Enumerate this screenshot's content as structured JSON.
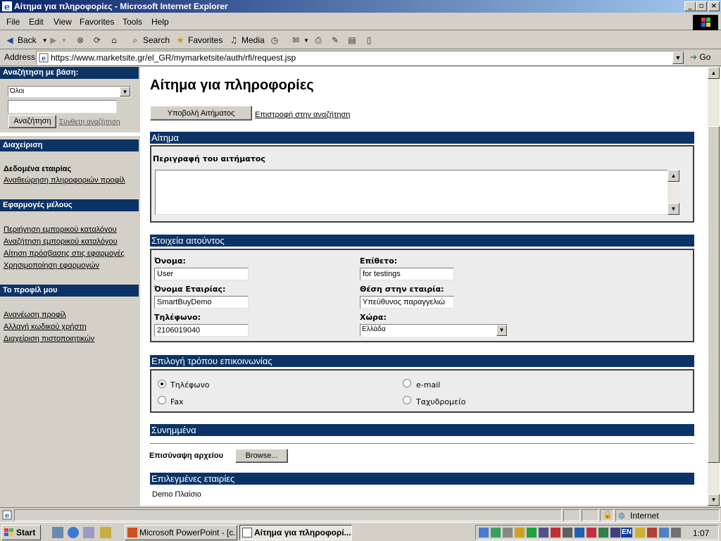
{
  "window": {
    "title": "Αίτημα για πληροφορίες - Microsoft Internet Explorer"
  },
  "menu": [
    "File",
    "Edit",
    "View",
    "Favorites",
    "Tools",
    "Help"
  ],
  "toolbar": {
    "back": "Back",
    "search": "Search",
    "favorites": "Favorites",
    "media": "Media"
  },
  "address": {
    "label": "Address",
    "url": "https://www.marketsite.gr/el_GR/mymarketsite/auth/rfi/request.jsp",
    "go": "Go"
  },
  "sidebar": {
    "search_head": "Αναζήτηση με βάση:",
    "search_select": "Όλοι",
    "search_input": "",
    "search_button": "Αναζήτηση",
    "advanced_search": "Σύνθετη αναζήτηση",
    "admin_head": "Διαχείριση",
    "company_data": "Δεδομένα εταιρίας",
    "review_profile": "Αναθεώρηση πληροφοριών προφίλ",
    "member_apps_head": "Εφαρμογές μέλους",
    "member_apps": [
      "Περιήγηση εμπορικού καταλόγου",
      "Αναζήτηση εμπορικού καταλόγου",
      "Αίτηση πρόσβασης στις εφαρμογές",
      "Χρησιμοποίηση εφαρμογών"
    ],
    "profile_head": "Το προφίλ μου",
    "profile_links": [
      "Ανανέωση προφίλ",
      "Αλλαγή κωδικού χρήστη",
      "Διαχείριση πιστοποιητικών"
    ]
  },
  "main": {
    "title": "Αίτημα για πληροφορίες",
    "submit_button": "Υποβολή Αιτήματος",
    "back_link": "Επιστροφή στην αναζήτηση",
    "request": {
      "head": "Αίτημα",
      "description_label": "Περιγραφή του αιτήματος",
      "description_value": ""
    },
    "requester": {
      "head": "Στοιχεία αιτούντος",
      "first_name_label": "Όνομα:",
      "first_name": "User",
      "last_name_label": "Επίθετο:",
      "last_name": "for testings",
      "company_label": "Όνομα Εταιρίας:",
      "company": "SmartBuyDemo",
      "position_label": "Θέση στην εταιρία:",
      "position": "Υπεύθυνος παραγγελιώ",
      "phone_label": "Τηλέφωνο:",
      "phone": "2106019040",
      "country_label": "Χώρα:",
      "country": "Ελλάδα"
    },
    "contact": {
      "head": "Επιλογή τρόπου επικοινωνίας",
      "options": [
        "Τηλέφωνο",
        "e-mail",
        "Fax",
        "Ταχυδρομείο"
      ],
      "selected": "Τηλέφωνο"
    },
    "attachments": {
      "head": "Συνημμένα",
      "label": "Επισύναψη αρχείου",
      "browse": "Browse..."
    },
    "companies": {
      "head": "Επιλεγμένες εταιρίες",
      "items": [
        "Demo Πλαίσιο"
      ]
    }
  },
  "status": {
    "zone": "Internet"
  },
  "taskbar": {
    "start": "Start",
    "tasks": [
      "Microsoft PowerPoint - [c...",
      "Αίτημα για πληροφορί..."
    ],
    "lang": "EN",
    "clock": "1:07"
  },
  "colors": {
    "section_header": "#0b3366",
    "titlebar_start": "#0a246a",
    "titlebar_end": "#a6caf0"
  }
}
